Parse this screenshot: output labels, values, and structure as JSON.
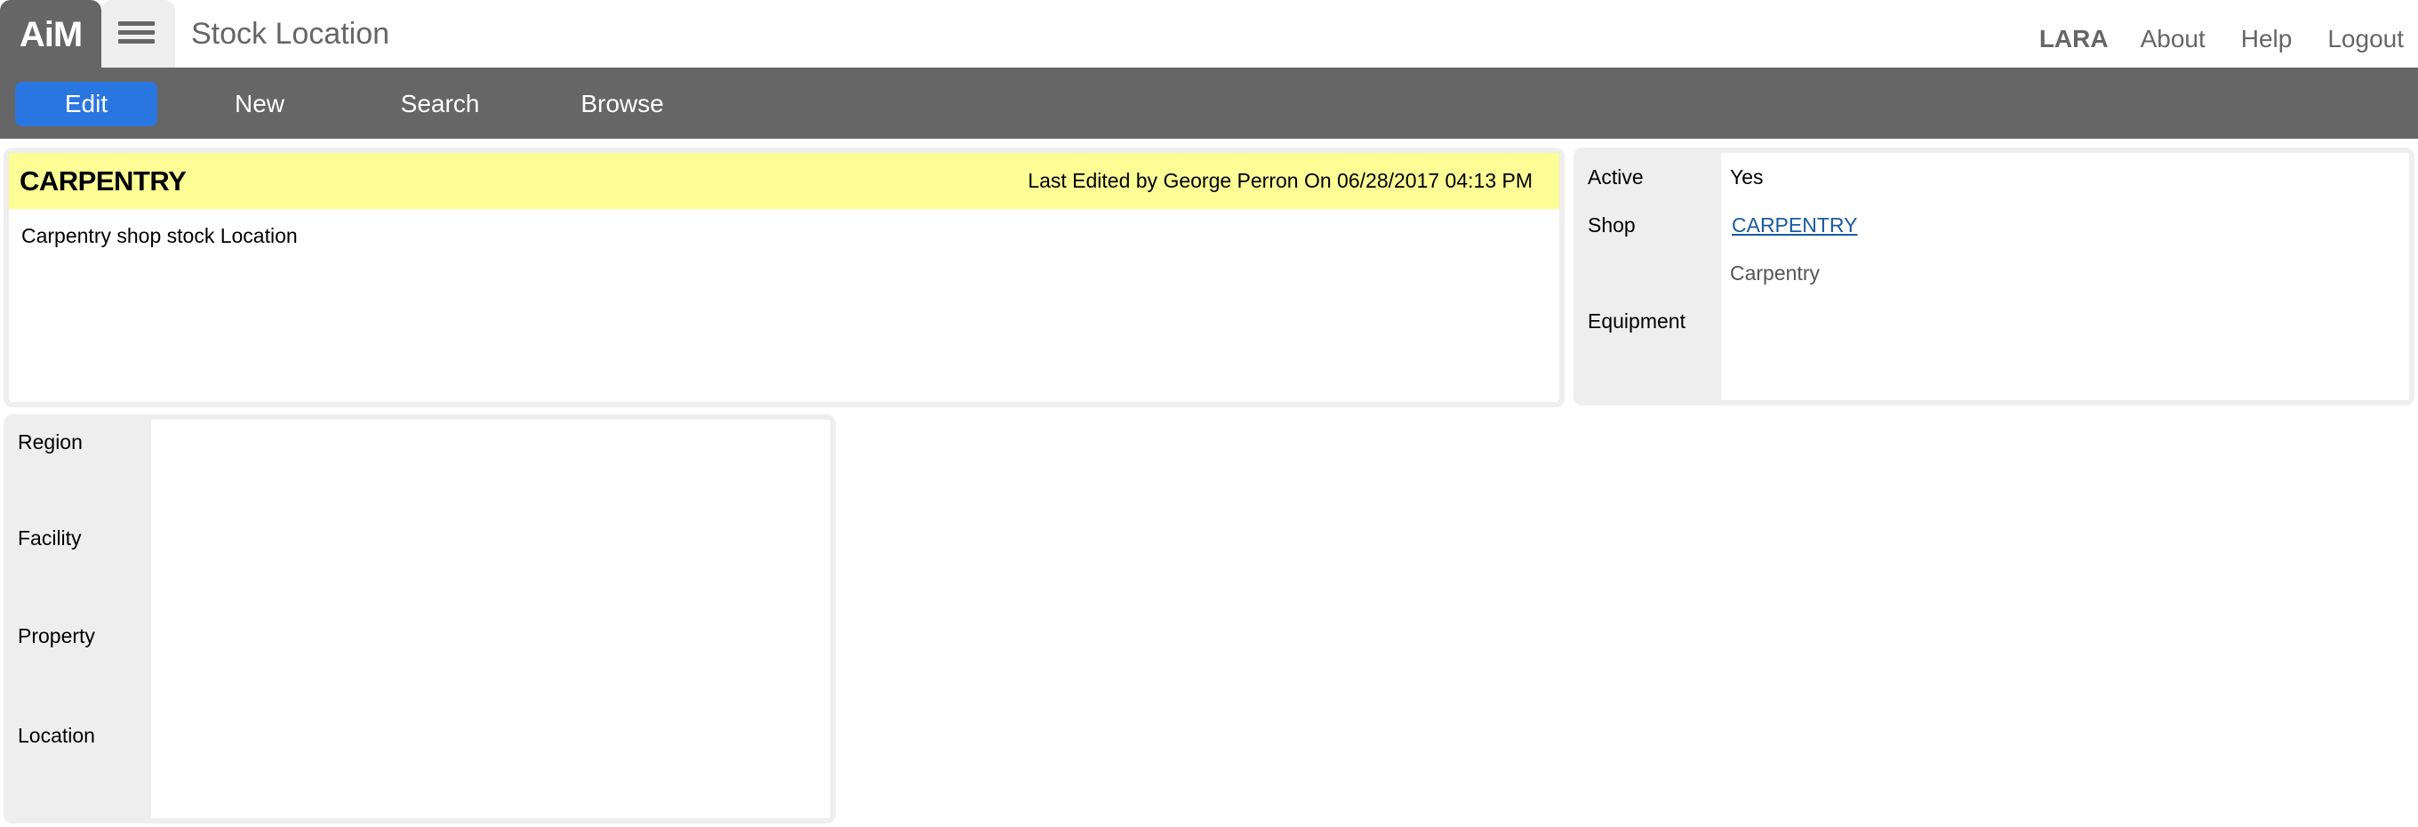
{
  "app": {
    "logo": "AiM",
    "page_title": "Stock Location",
    "menu_icon": "hamburger-icon"
  },
  "user_nav": {
    "user": "LARA",
    "links": [
      "About",
      "Help",
      "Logout"
    ]
  },
  "toolbar": {
    "buttons": [
      {
        "label": "Edit",
        "active": true
      },
      {
        "label": "New",
        "active": false
      },
      {
        "label": "Search",
        "active": false
      },
      {
        "label": "Browse",
        "active": false
      }
    ]
  },
  "record": {
    "title": "CARPENTRY",
    "last_edited": "Last Edited by George Perron On 06/28/2017 04:13 PM",
    "description": "Carpentry shop stock Location"
  },
  "details": {
    "active_label": "Active",
    "active_value": "Yes",
    "shop_label": "Shop",
    "shop_value": "CARPENTRY",
    "shop_description": "Carpentry",
    "equipment_label": "Equipment",
    "equipment_value": ""
  },
  "location": {
    "region_label": "Region",
    "region_value": "",
    "facility_label": "Facility",
    "facility_value": "",
    "property_label": "Property",
    "property_value": "",
    "location_label": "Location",
    "location_value": ""
  },
  "colors": {
    "header_gray": "#666666",
    "active_button": "#2a76e0",
    "record_header_yellow": "#fdfd96",
    "panel_gray": "#eeeeee",
    "link_blue": "#1a5aa0"
  }
}
